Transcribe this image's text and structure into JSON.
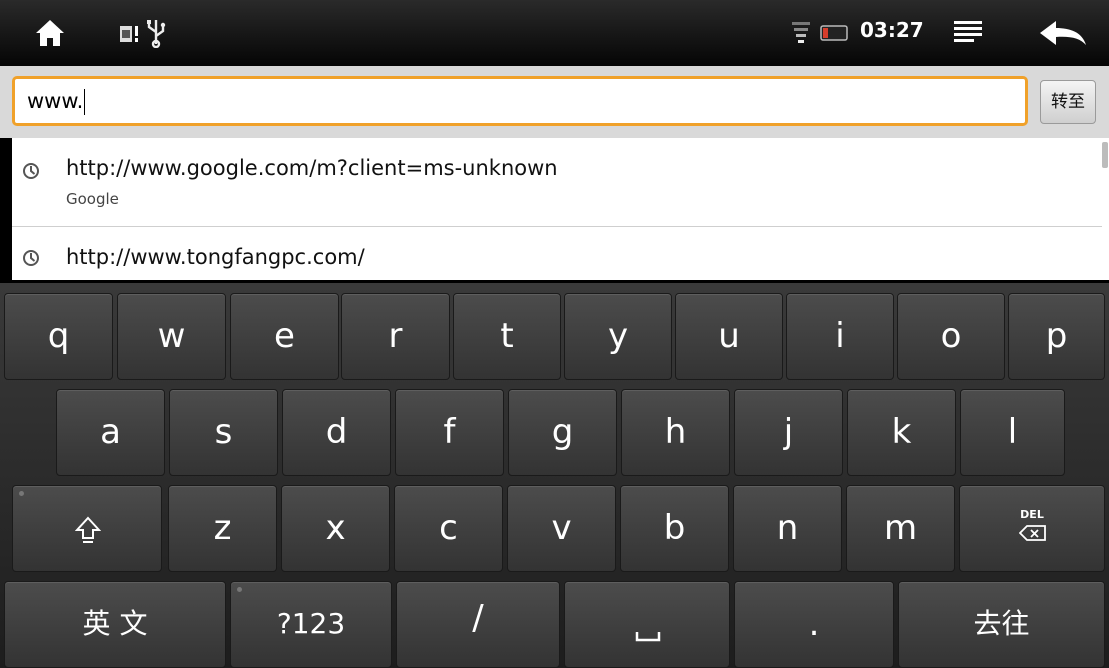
{
  "status_bar": {
    "time": "03:27",
    "icons": [
      "home-icon",
      "sim-card-icon",
      "usb-icon",
      "wifi-icon",
      "battery-icon",
      "menu-icon",
      "back-arrow-icon"
    ]
  },
  "url_bar": {
    "value": "www.",
    "go_label": "转至",
    "focus_color": "#f0a12a"
  },
  "suggestions": [
    {
      "url": "http://www.google.com/m?client=ms-unknown",
      "title": "Google",
      "icon": "history-clock-icon"
    },
    {
      "url": "http://www.tongfangpc.com/",
      "title": "",
      "icon": "history-clock-icon"
    }
  ],
  "keyboard": {
    "row1": [
      "q",
      "w",
      "e",
      "r",
      "t",
      "y",
      "u",
      "i",
      "o",
      "p"
    ],
    "row2": [
      "a",
      "s",
      "d",
      "f",
      "g",
      "h",
      "j",
      "k",
      "l"
    ],
    "row3": [
      "z",
      "x",
      "c",
      "v",
      "b",
      "n",
      "m"
    ],
    "shift_icon": "shift-icon",
    "delete_label": "DEL",
    "language_label": "英 文",
    "symbols_label": "?123",
    "slash_label": "/",
    "space_icon": "space-icon",
    "period_label": ".",
    "go_label": "去往"
  }
}
